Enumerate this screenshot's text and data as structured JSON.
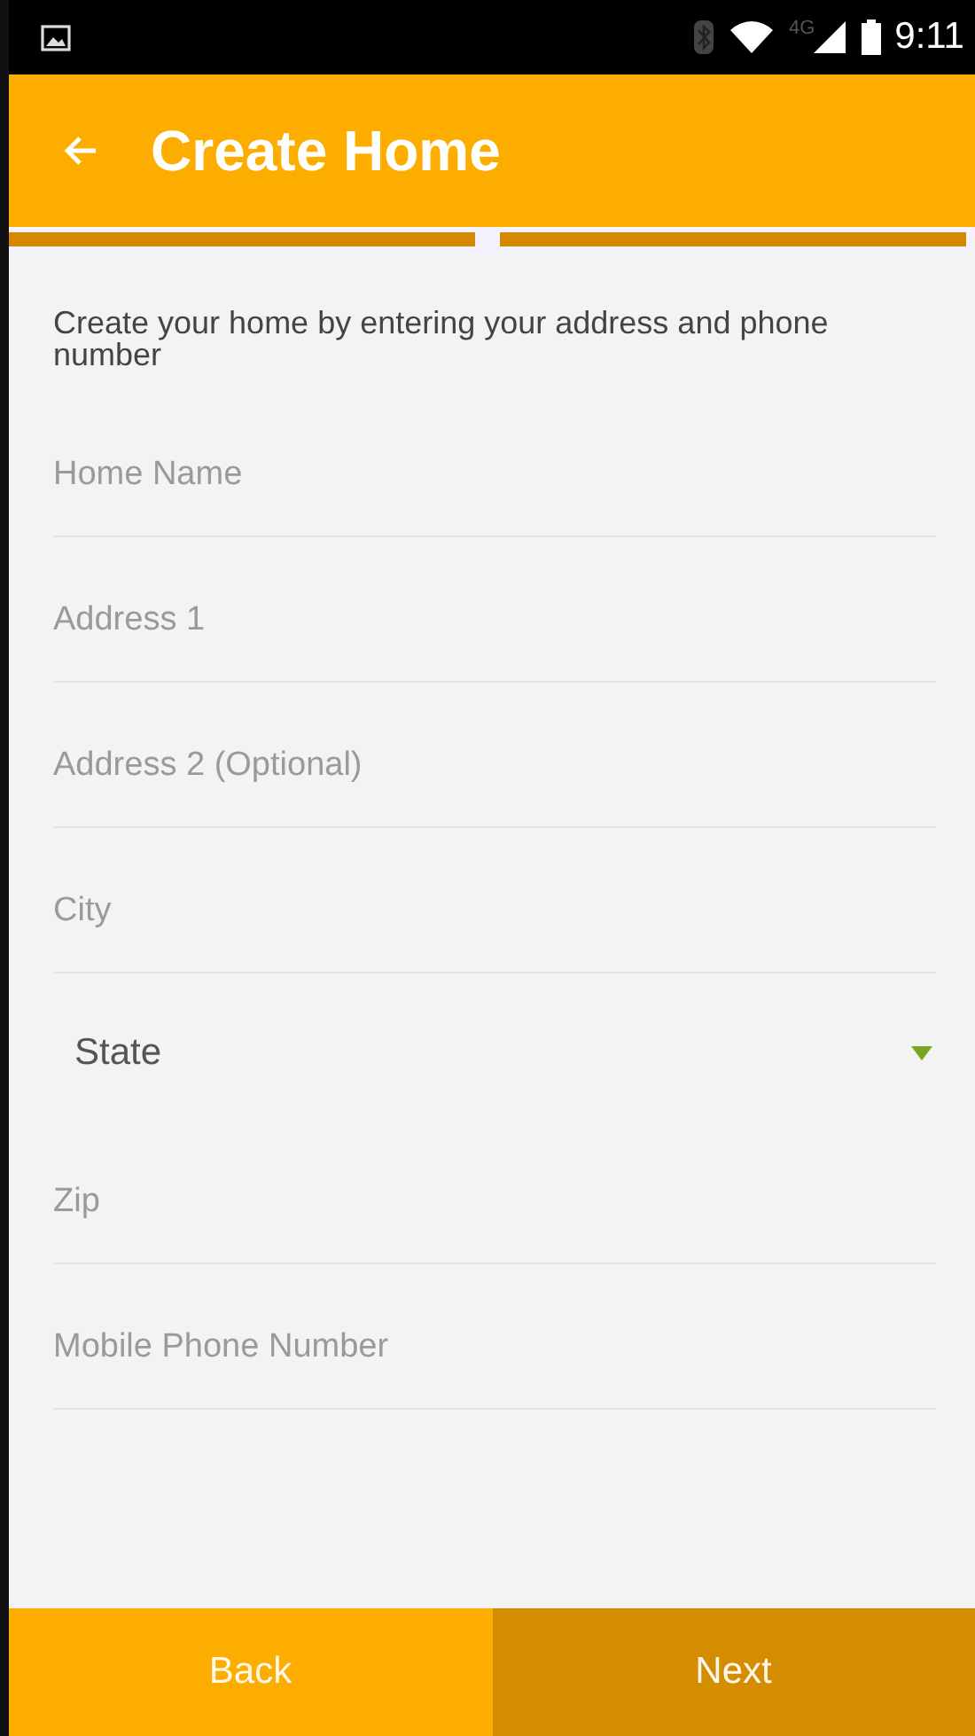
{
  "status_bar": {
    "network": "4G",
    "time": "9:11"
  },
  "app_bar": {
    "title": "Create Home"
  },
  "progress": [
    {
      "done": true
    },
    {
      "done": true
    }
  ],
  "intro": "Create your home by entering your address and phone number",
  "fields": [
    {
      "kind": "text",
      "placeholder": "Home Name"
    },
    {
      "kind": "text",
      "placeholder": "Address 1"
    },
    {
      "kind": "text",
      "placeholder": "Address 2 (Optional)"
    },
    {
      "kind": "text",
      "placeholder": "City"
    },
    {
      "kind": "select",
      "value": "State"
    },
    {
      "kind": "text",
      "placeholder": "Zip"
    },
    {
      "kind": "text",
      "placeholder": "Mobile Phone Number"
    }
  ],
  "buttons": [
    {
      "label": "Back",
      "kind": "secondary"
    },
    {
      "label": "Next",
      "kind": "primary"
    }
  ]
}
